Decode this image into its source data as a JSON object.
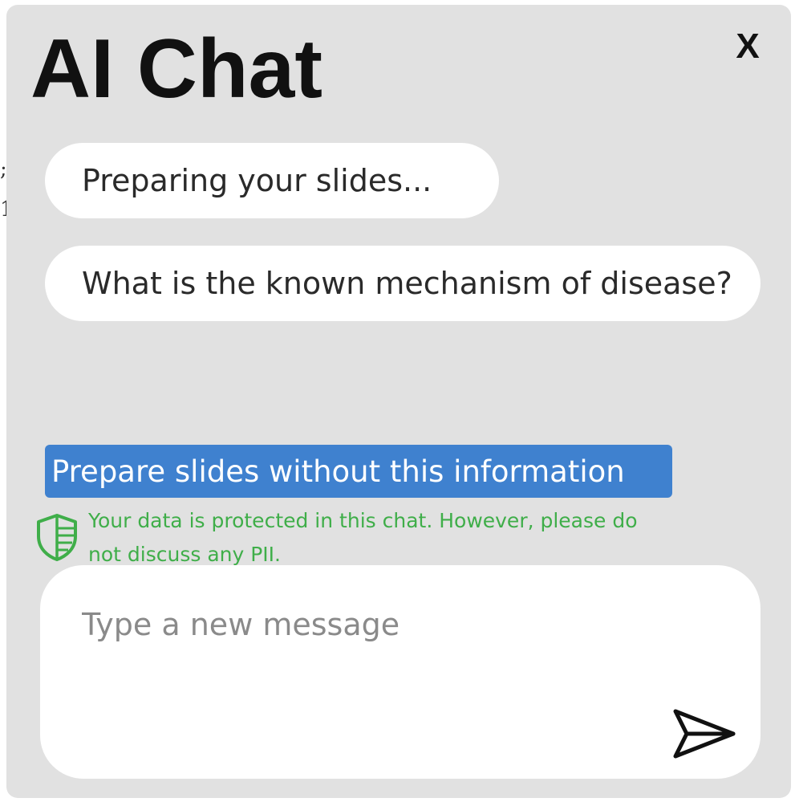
{
  "window": {
    "title": "AI Chat",
    "close_label": "X"
  },
  "messages": [
    {
      "text": "Preparing your slides..."
    },
    {
      "text": "What is the known mechanism of disease?"
    }
  ],
  "actions": {
    "prepare_without_label": "Prepare slides without this information"
  },
  "privacy_notice": {
    "icon": "shield-icon",
    "line1": "Your data is protected in this chat. However, please do",
    "line2": "not discuss any PII.",
    "color": "#3fae49"
  },
  "composer": {
    "placeholder": "Type a new message",
    "value": "",
    "send_icon": "send-icon"
  },
  "colors": {
    "panel_background": "#e1e1e1",
    "accent": "#3f81cf",
    "bubble_background": "#ffffff"
  }
}
